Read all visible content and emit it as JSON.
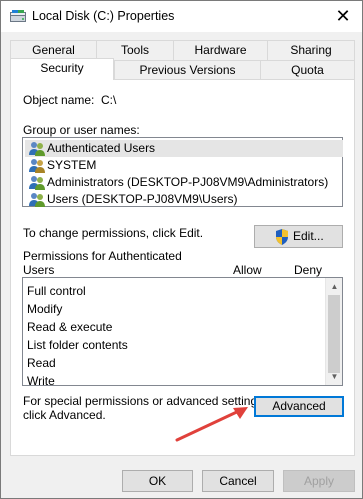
{
  "window": {
    "title": "Local Disk (C:) Properties",
    "close_glyph": "✕"
  },
  "tabs": {
    "row1": [
      "General",
      "Tools",
      "Hardware",
      "Sharing"
    ],
    "row2": [
      "Security",
      "Previous Versions",
      "Quota"
    ],
    "active": "Security"
  },
  "security": {
    "object_name_label": "Object name:",
    "object_name_value": "C:\\",
    "group_label": "Group or user names:",
    "groups": [
      "Authenticated Users",
      "SYSTEM",
      "Administrators (DESKTOP-PJ08VM9\\Administrators)",
      "Users (DESKTOP-PJ08VM9\\Users)"
    ],
    "selected_group": "Authenticated Users",
    "change_text": "To change permissions, click Edit.",
    "edit_button": "Edit...",
    "permissions_label_line1": "Permissions for Authenticated",
    "permissions_label_line2": "Users",
    "allow_header": "Allow",
    "deny_header": "Deny",
    "permissions": [
      "Full control",
      "Modify",
      "Read & execute",
      "List folder contents",
      "Read",
      "Write"
    ],
    "special_text_line1": "For special permissions or advanced settings,",
    "special_text_line2": "click Advanced.",
    "advanced_button": "Advanced"
  },
  "footer": {
    "ok": "OK",
    "cancel": "Cancel",
    "apply": "Apply"
  },
  "colors": {
    "focus_border": "#0078d7",
    "arrow": "#e0413b"
  },
  "icons": {
    "title": "drive-icon",
    "group": "users-group-icon",
    "edit": "uac-shield-icon"
  }
}
